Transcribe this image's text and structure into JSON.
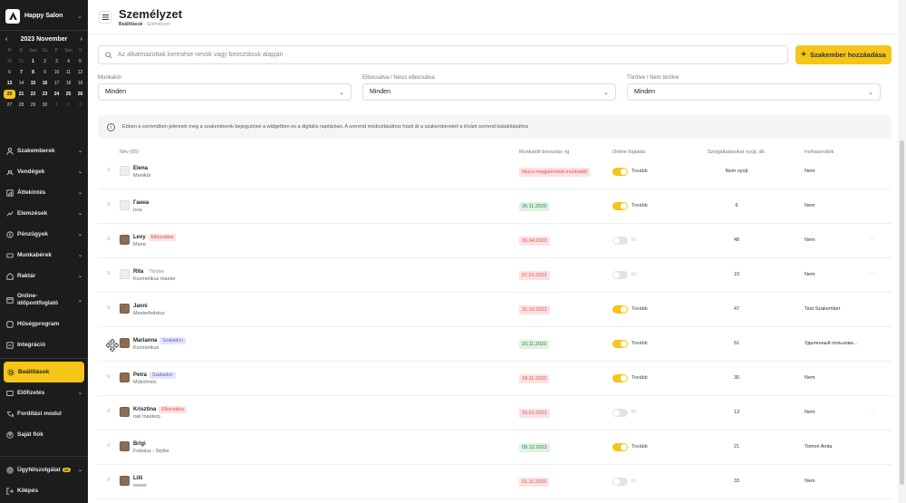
{
  "brand": {
    "name": "Happy Salon"
  },
  "calendar": {
    "title": "2023 November",
    "dow": [
      "H",
      "K",
      "Sze",
      "Cs",
      "P",
      "Szo",
      "V"
    ],
    "weeks": [
      [
        {
          "d": "30",
          "c": "muted"
        },
        {
          "d": "31",
          "c": "muted"
        },
        {
          "d": "1",
          "c": "bold"
        },
        {
          "d": "2",
          "c": ""
        },
        {
          "d": "3",
          "c": ""
        },
        {
          "d": "4",
          "c": ""
        },
        {
          "d": "5",
          "c": ""
        }
      ],
      [
        {
          "d": "6",
          "c": ""
        },
        {
          "d": "7",
          "c": "bold"
        },
        {
          "d": "8",
          "c": "bold"
        },
        {
          "d": "9",
          "c": ""
        },
        {
          "d": "10",
          "c": ""
        },
        {
          "d": "11",
          "c": ""
        },
        {
          "d": "12",
          "c": ""
        }
      ],
      [
        {
          "d": "13",
          "c": "bold"
        },
        {
          "d": "14",
          "c": ""
        },
        {
          "d": "15",
          "c": "bold"
        },
        {
          "d": "16",
          "c": "bold"
        },
        {
          "d": "17",
          "c": ""
        },
        {
          "d": "18",
          "c": ""
        },
        {
          "d": "19",
          "c": ""
        }
      ],
      [
        {
          "d": "20",
          "c": "today"
        },
        {
          "d": "21",
          "c": "bold"
        },
        {
          "d": "22",
          "c": "bold"
        },
        {
          "d": "23",
          "c": "bold"
        },
        {
          "d": "24",
          "c": "bold"
        },
        {
          "d": "25",
          "c": "bold"
        },
        {
          "d": "26",
          "c": "bold"
        }
      ],
      [
        {
          "d": "27",
          "c": ""
        },
        {
          "d": "28",
          "c": ""
        },
        {
          "d": "29",
          "c": ""
        },
        {
          "d": "30",
          "c": ""
        },
        {
          "d": "1",
          "c": "muted"
        },
        {
          "d": "2",
          "c": "muted"
        },
        {
          "d": "3",
          "c": "muted"
        }
      ]
    ]
  },
  "nav": [
    {
      "name": "nav-szakemberek",
      "label": "Szakemberek",
      "chev": true
    },
    {
      "name": "nav-vendegek",
      "label": "Vendégek",
      "chev": true
    },
    {
      "name": "nav-attekintes",
      "label": "Áttekintés",
      "chev": true
    },
    {
      "name": "nav-elemzesek",
      "label": "Elemzések",
      "chev": true
    },
    {
      "name": "nav-penzugyek",
      "label": "Pénzügyek",
      "chev": true
    },
    {
      "name": "nav-munkaberek",
      "label": "Munkabérek",
      "chev": true
    },
    {
      "name": "nav-raktar",
      "label": "Raktár",
      "chev": true
    },
    {
      "name": "nav-online",
      "label": "Online-időpontfoglaló",
      "chev": true
    },
    {
      "name": "nav-husegprogram",
      "label": "Hűségprogram",
      "chev": false
    },
    {
      "name": "nav-integracio",
      "label": "Integráció",
      "chev": false
    }
  ],
  "nav2": [
    {
      "name": "nav-beallitasok",
      "label": "Beállítások",
      "chev": false,
      "active": true
    },
    {
      "name": "nav-elofizetes",
      "label": "Előfizetés",
      "chev": true
    },
    {
      "name": "nav-forditasi",
      "label": "Fordítási modul",
      "chev": false
    },
    {
      "name": "nav-sajat-fiok",
      "label": "Saját fiók",
      "chev": false
    }
  ],
  "nav3": {
    "support": "Ügyfélszolgálat",
    "support_badge": "10",
    "logout": "Kilépés"
  },
  "header": {
    "title": "Személyzet",
    "breadcrumb_parent": "Beállítások",
    "breadcrumb_sep": "·",
    "breadcrumb_current": "Személyzet"
  },
  "search": {
    "placeholder": "Az alkalmazottak keresése nevük vagy beosztásuk alapján"
  },
  "add_button": "Szakember hozzáadása",
  "filters": [
    {
      "label": "Munkakör",
      "value": "Minden"
    },
    {
      "label": "Elbocsátva / Nincs elbocsátva",
      "value": "Minden"
    },
    {
      "label": "Törölve / Nem törölve",
      "value": "Minden"
    }
  ],
  "info_text": "Ebben a sorrendben jelennek meg a szakemberek bejegyzései a widgetben és a digitális naptárban. A sorrend módosításához húzd át a szakembereket a kívánt sorrend kialakításához",
  "columns": {
    "name": "Név (65)",
    "workday": "Munkaidő-beosztás -ig",
    "online": "Online foglalás",
    "services": "Szolgáltatásokat nyújt, db.",
    "user": "Felhasználók"
  },
  "staff": [
    {
      "name": "Elena",
      "role": "Manikűr",
      "tag": "",
      "tagc": "",
      "photo": false,
      "wd": "Nincs megjelenített munkaidő",
      "wdc": "r",
      "on": true,
      "onl": "Tovább",
      "svc": "Nem nyújt",
      "usr": "Nem",
      "more": false
    },
    {
      "name": "Ганна",
      "role": "Інга",
      "tag": "",
      "tagc": "",
      "photo": false,
      "wd": "26.11.2023",
      "wdc": "g",
      "on": true,
      "onl": "Tovább",
      "svc": "6",
      "usr": "Nem",
      "more": false
    },
    {
      "name": "Levy",
      "role": "Manic",
      "tag": "Elbocsátva",
      "tagc": "red",
      "photo": true,
      "wd": "26.04.2023",
      "wdc": "r",
      "on": false,
      "onl": "Ki",
      "svc": "48",
      "usr": "Nem",
      "more": true
    },
    {
      "name": "Rita",
      "role": "Kozmetikus master",
      "tag": "Törölve",
      "tagc": "plain",
      "photo": false,
      "wd": "07.01.2022",
      "wdc": "r",
      "on": false,
      "onl": "Ki",
      "svc": "10",
      "usr": "Nem",
      "more": true
    },
    {
      "name": "Janni",
      "role": "Mesterfodrász",
      "tag": "",
      "tagc": "",
      "photo": true,
      "wd": "31.10.2023",
      "wdc": "r",
      "on": true,
      "onl": "Tovább",
      "svc": "47",
      "usr": "Test Szakember",
      "more": false
    },
    {
      "name": "Marianna",
      "role": "Kozmetikus",
      "tag": "Szabadon",
      "tagc": "blue",
      "photo": true,
      "wd": "23.11.2023",
      "wdc": "g",
      "on": true,
      "onl": "Tovább",
      "svc": "51",
      "usr": "Удаленный пользова...",
      "more": false
    },
    {
      "name": "Petra",
      "role": "Műkörmös",
      "tag": "Szabadon",
      "tagc": "blue",
      "photo": true,
      "wd": "18.11.2023",
      "wdc": "r",
      "on": true,
      "onl": "Tovább",
      "svc": "30",
      "usr": "Nem",
      "more": false
    },
    {
      "name": "Krisztina",
      "role": "nail masterp",
      "tag": "Elbocsátva",
      "tagc": "red",
      "photo": true,
      "wd": "15.01.2023",
      "wdc": "r",
      "on": false,
      "onl": "Ki",
      "svc": "13",
      "usr": "Nem",
      "more": true
    },
    {
      "name": "Brigi",
      "role": "Fodrász - Stylist",
      "tag": "",
      "tagc": "",
      "photo": true,
      "wd": "09.12.2023",
      "wdc": "g",
      "on": true,
      "onl": "Tovább",
      "svc": "21",
      "usr": "Tomori Anita",
      "more": false
    },
    {
      "name": "Lilli",
      "role": "owner",
      "tag": "",
      "tagc": "",
      "photo": true,
      "wd": "01.11.2023",
      "wdc": "r",
      "on": false,
      "onl": "Ki",
      "svc": "33",
      "usr": "Nem",
      "more": false
    }
  ]
}
